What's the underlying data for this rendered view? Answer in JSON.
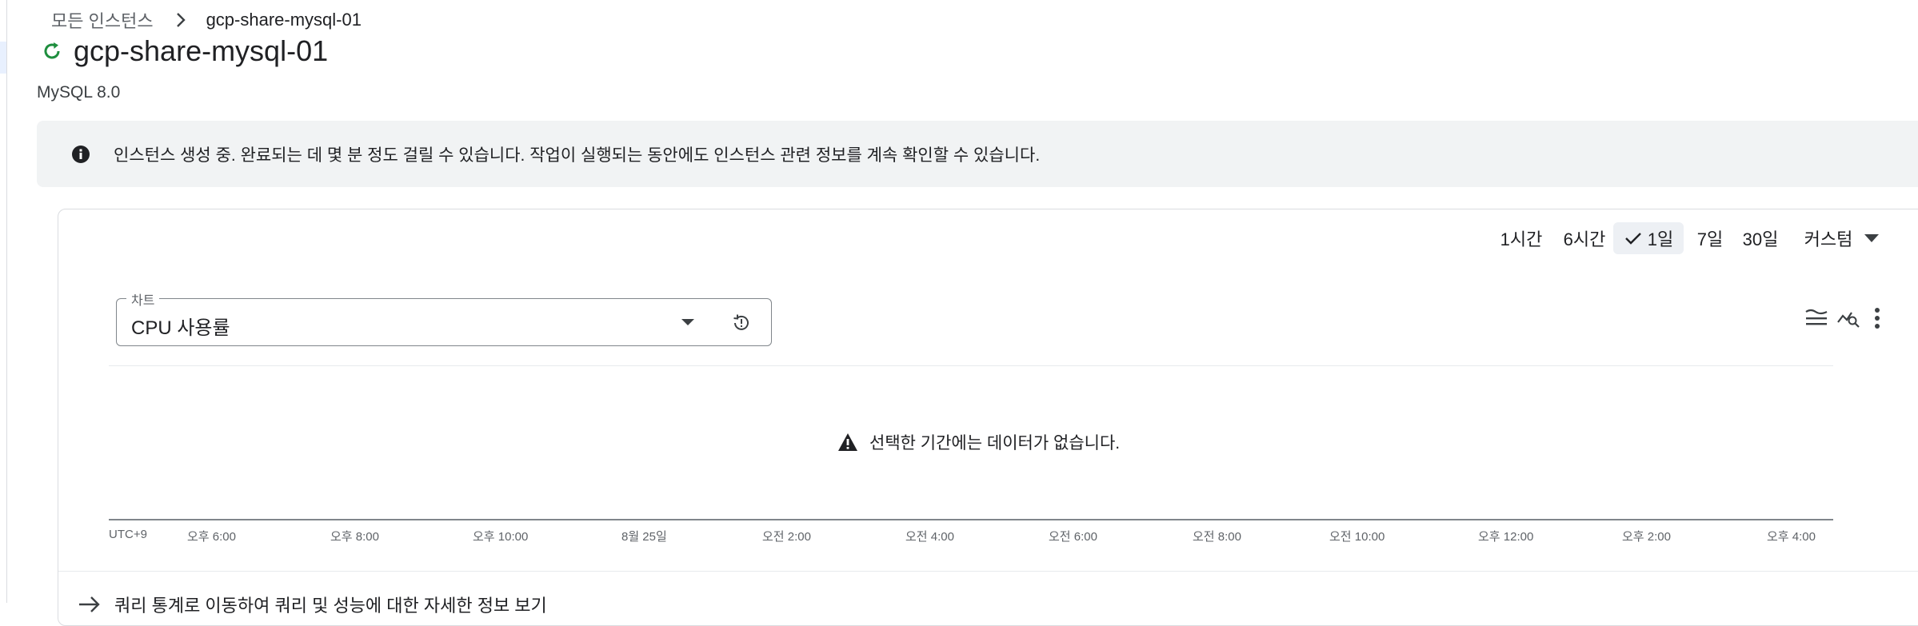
{
  "breadcrumb": {
    "root": "모든 인스턴스",
    "current": "gcp-share-mysql-01"
  },
  "instance": {
    "title": "gcp-share-mysql-01",
    "version": "MySQL 8.0",
    "status_icon": "refresh-spinner-icon"
  },
  "banner": {
    "text": "인스턴스 생성 중. 완료되는 데 몇 분 정도 걸릴 수 있습니다. 작업이 실행되는 동안에도 인스턴스 관련 정보를 계속 확인할 수 있습니다."
  },
  "time_range": {
    "options": [
      "1시간",
      "6시간",
      "1일",
      "7일",
      "30일",
      "커스텀"
    ],
    "selected": "1일"
  },
  "chart_select": {
    "legend": "차트",
    "value": "CPU 사용률"
  },
  "chart": {
    "empty_message": "선택한 기간에는 데이터가 없습니다.",
    "timezone": "UTC+9",
    "x_ticks": [
      "오후 6:00",
      "오후 8:00",
      "오후 10:00",
      "8월 25일",
      "오전 2:00",
      "오전 4:00",
      "오전 6:00",
      "오전 8:00",
      "오전 10:00",
      "오후 12:00",
      "오후 2:00",
      "오후 4:00"
    ]
  },
  "bottom_link": {
    "text": "쿼리 통계로 이동하여 쿼리 및 성능에 대한 자세한 정보 보기"
  },
  "colors": {
    "status_green": "#1e8e3e",
    "banner_bg": "#f1f3f4",
    "selected_bg": "#edf0f4"
  }
}
